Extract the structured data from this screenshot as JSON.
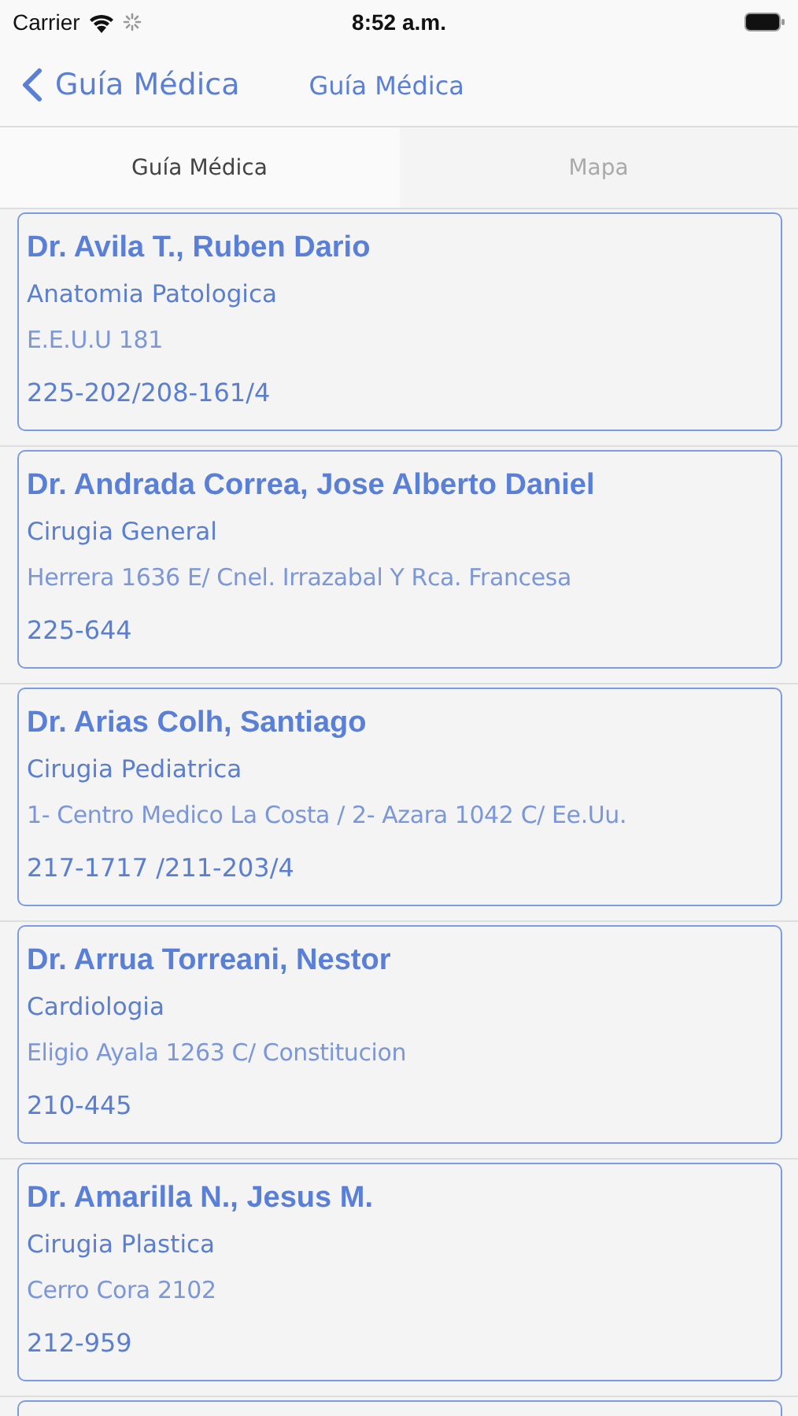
{
  "status_bar": {
    "carrier": "Carrier",
    "time": "8:52 a.m."
  },
  "nav": {
    "back_label": "Guía Médica",
    "title": "Guía Médica"
  },
  "tabs": [
    {
      "label": "Guía Médica",
      "selected": true
    },
    {
      "label": "Mapa",
      "selected": false
    }
  ],
  "doctors": [
    {
      "name": "Dr. Avila T., Ruben Dario",
      "specialty": "Anatomia Patologica",
      "address": "E.E.U.U 181",
      "phone": "225-202/208-161/4"
    },
    {
      "name": "Dr. Andrada Correa, Jose Alberto Daniel",
      "specialty": "Cirugia General",
      "address": "Herrera 1636 E/ Cnel. Irrazabal Y Rca. Francesa",
      "phone": "225-644"
    },
    {
      "name": "Dr. Arias Colh, Santiago",
      "specialty": "Cirugia Pediatrica",
      "address": "1- Centro Medico La Costa / 2- Azara 1042 C/ Ee.Uu.",
      "phone": "217-1717 /211-203/4"
    },
    {
      "name": "Dr. Arrua Torreani, Nestor",
      "specialty": "Cardiologia",
      "address": "Eligio Ayala 1263 C/ Constitucion",
      "phone": "210-445"
    },
    {
      "name": "Dr. Amarilla N., Jesus M.",
      "specialty": "Cirugia Plastica",
      "address": "Cerro Cora 2102",
      "phone": "212-959"
    }
  ]
}
